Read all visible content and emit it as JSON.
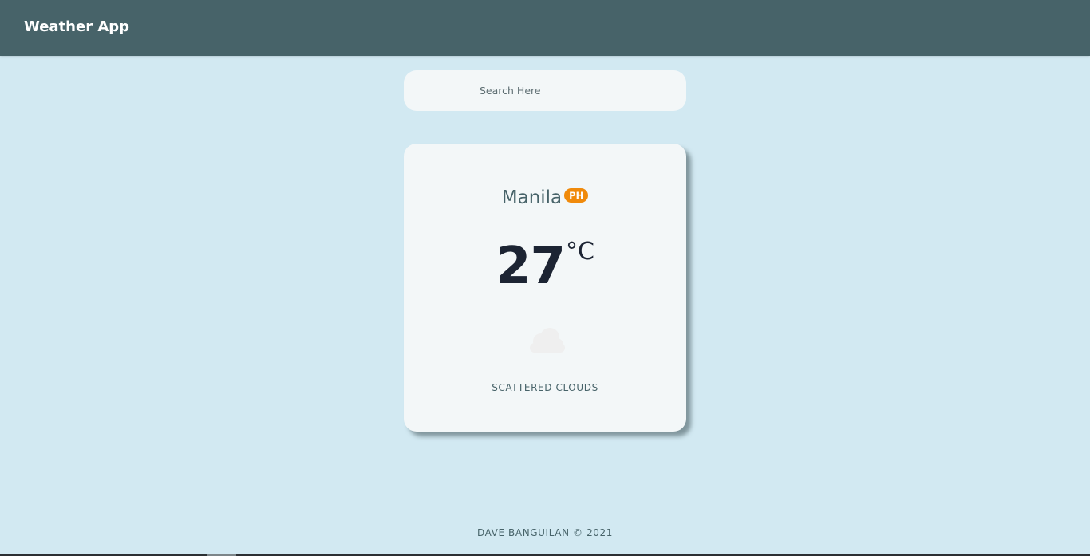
{
  "app": {
    "title": "Weather App"
  },
  "search": {
    "placeholder": "Search Here",
    "value": ""
  },
  "weather": {
    "city": "Manila",
    "country_code": "PH",
    "temperature": "27",
    "unit": "°C",
    "icon": "cloud-icon",
    "description": "SCATTERED CLOUDS"
  },
  "footer": {
    "text": "DAVE BANGUILAN © 2021"
  },
  "colors": {
    "background": "#d2e9f2",
    "navbar": "#476369",
    "card": "#f3f7f8",
    "badge": "#f08a0b",
    "temperature_text": "#1c2433"
  }
}
